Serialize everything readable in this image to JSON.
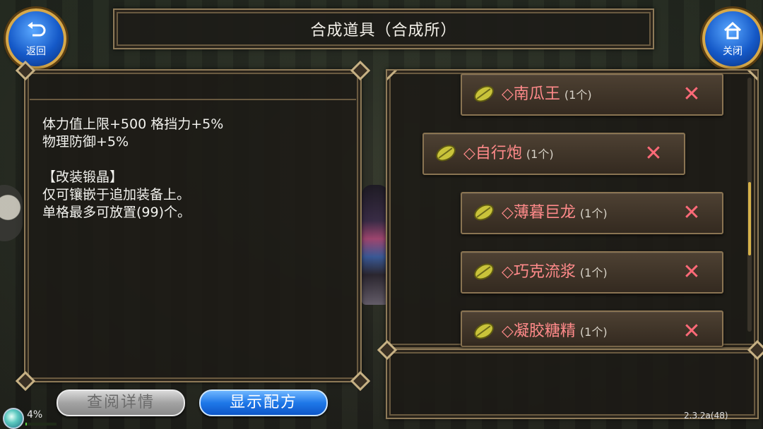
{
  "header": {
    "title": "合成道具（合成所）",
    "back_label": "返回",
    "close_label": "关闭"
  },
  "description": {
    "text": "体力值上限+500 格挡力+5%\n物理防御+5%\n\n【改装锻晶】\n仅可镶嵌于追加装备上。\n单格最多可放置(99)个。"
  },
  "materials": [
    {
      "name": "◇南瓜王",
      "qty": "(1个)"
    },
    {
      "name": "◇自行炮",
      "qty": "(1个)"
    },
    {
      "name": "◇薄暮巨龙",
      "qty": "(1个)"
    },
    {
      "name": "◇巧克流浆",
      "qty": "(1个)"
    },
    {
      "name": "◇凝胶糖精",
      "qty": "(1个)"
    }
  ],
  "buttons": {
    "details": "查阅详情",
    "show_recipe": "显示配方"
  },
  "status": {
    "percent": "4%",
    "progress": 0.04,
    "version": "2.3.2a(48)"
  },
  "colors": {
    "item_name": "#ff8a8a",
    "remove_icon": "#ff6a78",
    "primary_button": "#1f78e8",
    "frame_border": "#8e7a58"
  },
  "icons": {
    "material": "leaf-icon",
    "remove": "close-x-icon",
    "back": "back-arrow-icon",
    "close": "home-icon"
  }
}
